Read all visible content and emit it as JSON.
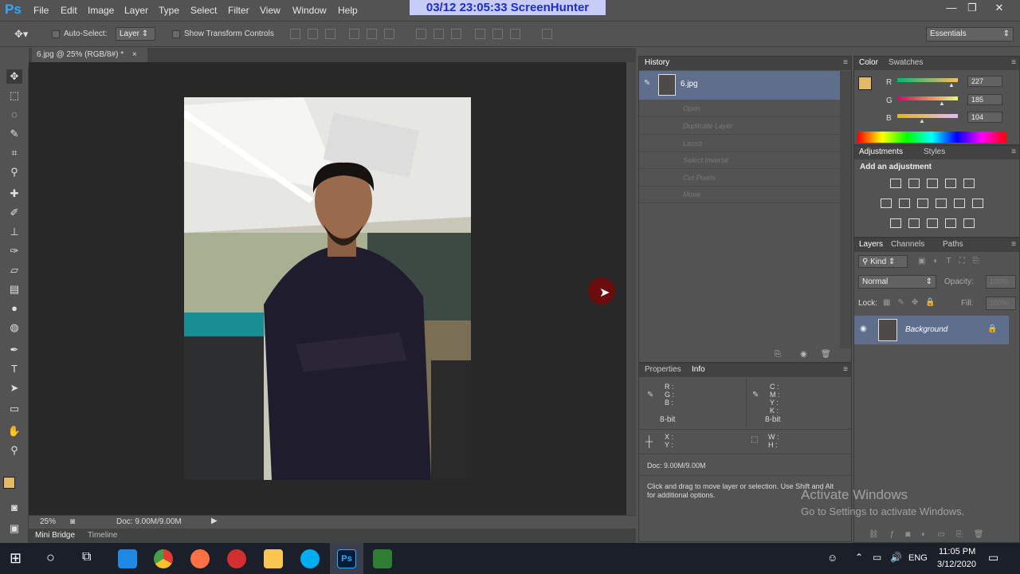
{
  "app": {
    "logo": "Ps"
  },
  "menu": [
    "File",
    "Edit",
    "Image",
    "Layer",
    "Type",
    "Select",
    "Filter",
    "View",
    "Window",
    "Help"
  ],
  "screenhunter_stamp": "03/12  23:05:33  ScreenHunter",
  "options_bar": {
    "auto_select_label": "Auto-Select:",
    "auto_select_value": "Layer",
    "show_transform_label": "Show Transform Controls",
    "workspace": "Essentials"
  },
  "document": {
    "tab_title": "6.jpg @ 25% (RGB/8#) *",
    "tab_close": "×",
    "zoom": "25%",
    "doc_size": "Doc: 9.00M/9.00M"
  },
  "bottom_tabs": [
    "Mini Bridge",
    "Timeline"
  ],
  "history": {
    "title": "History",
    "snapshot": "6.jpg",
    "items": [
      "Open",
      "Duplicate Layer",
      "Lasso",
      "Select Inverse",
      "Cut Pixels",
      "Move"
    ]
  },
  "color_panel": {
    "tabs": [
      "Color",
      "Swatches"
    ],
    "r": "227",
    "g": "185",
    "b": "104",
    "r_label": "R",
    "g_label": "G",
    "b_label": "B",
    "swatch_color": "#e3b968"
  },
  "adjustments": {
    "tabs": [
      "Adjustments",
      "Styles"
    ],
    "heading": "Add an adjustment"
  },
  "layers": {
    "tabs": [
      "Layers",
      "Channels",
      "Paths"
    ],
    "kind": "Kind",
    "blend_mode": "Normal",
    "opacity_label": "Opacity:",
    "opacity_value": "100%",
    "lock_label": "Lock:",
    "fill_label": "Fill:",
    "fill_value": "100%",
    "layer_name": "Background"
  },
  "info_panel": {
    "tabs": [
      "Properties",
      "Info"
    ],
    "rgb_labels": "R :\nG :\nB :",
    "cmyk_labels": "C :\nM :\nY :\nK :",
    "bit1": "8-bit",
    "bit2": "8-bit",
    "xy_labels": "X :\nY :",
    "wh_labels": "W :\nH :",
    "doc": "Doc: 9.00M/9.00M",
    "hint": "Click and drag to move layer or selection.  Use Shift and Alt for additional options."
  },
  "watermark": {
    "line1": "Activate Windows",
    "line2": "Go to Settings to activate Windows."
  },
  "taskbar": {
    "time": "11:05 PM",
    "date": "3/12/2020",
    "lang": "ENG"
  }
}
